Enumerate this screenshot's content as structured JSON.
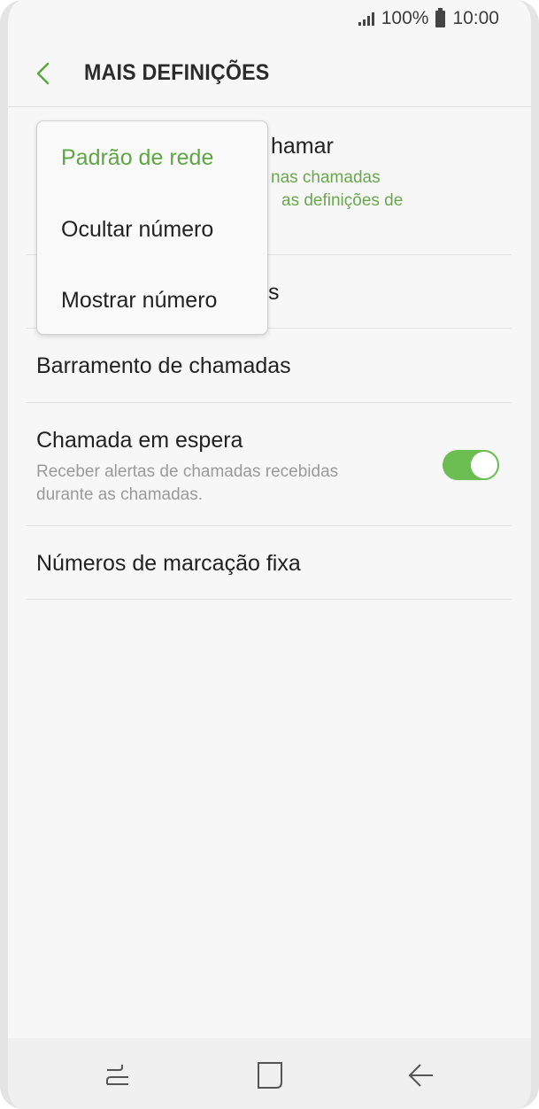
{
  "status_bar": {
    "battery": "100%",
    "time": "10:00",
    "icons": [
      "signal-icon",
      "battery-icon"
    ]
  },
  "header": {
    "title": "MAIS DEFINIÇÕES",
    "back_icon": "back-arrow-icon"
  },
  "popup": {
    "options": [
      "Padrão de rede",
      "Ocultar número",
      "Mostrar número"
    ],
    "selected": "Padrão de rede"
  },
  "items": {
    "caller_id": {
      "title_visible": "hamar",
      "sub_line1_visible": "nas chamadas",
      "sub_line2_visible": "as definições de"
    },
    "second_item_visible": "s",
    "call_barring": {
      "title": "Barramento de chamadas"
    },
    "call_waiting": {
      "title": "Chamada em espera",
      "sub_line1": "Receber alertas de chamadas recebidas",
      "sub_line2": "durante as chamadas.",
      "enabled": true
    },
    "fdn": {
      "title": "Números de marcação fixa"
    }
  },
  "nav_bar": {
    "icons": [
      "recents-icon",
      "home-icon",
      "back-icon"
    ]
  },
  "colors": {
    "accent": "#5da743",
    "toggle_on": "#6cbe53",
    "background": "#f7f7f7"
  }
}
